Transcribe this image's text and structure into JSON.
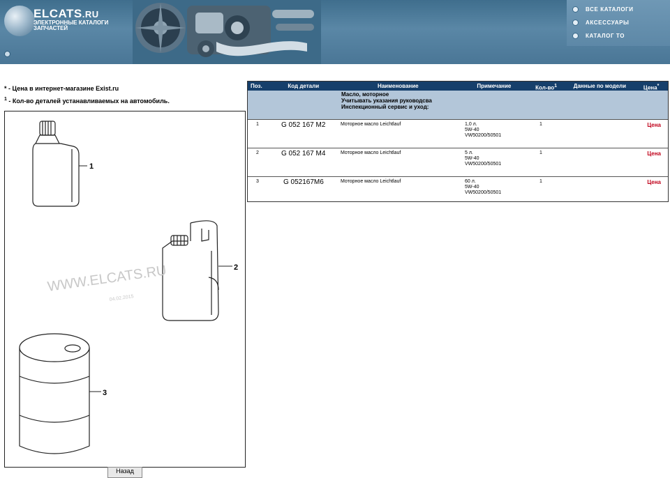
{
  "header": {
    "logo_title": "ELCATS",
    "logo_tld": ".RU",
    "logo_sub_1": "ЭЛЕКТРОННЫЕ КАТАЛОГИ",
    "logo_sub_2": "ЗАПЧАСТЕЙ",
    "nav": [
      {
        "label": "ВСЕ КАТАЛОГИ"
      },
      {
        "label": "АКСЕССУАРЫ"
      },
      {
        "label": "КАТАЛОГ ТО"
      }
    ]
  },
  "notes": {
    "star_mark": "*",
    "star_text": " - Цена в интернет-магазине Exist.ru",
    "qty_mark": "1",
    "qty_text": " - Кол-во деталей устанавливаемых на автомобиль."
  },
  "illustration": {
    "watermark": "WWW.ELCATS.RU",
    "date": "04.02.2015",
    "callouts": [
      "1",
      "2",
      "3"
    ],
    "print_button": "Назад"
  },
  "table": {
    "headers": {
      "pos": "Поз.",
      "code": "Код детали",
      "name": "Наименование",
      "note": "Примечание",
      "qty": "Кол-во",
      "qty_sup": "1",
      "model": "Данные по модели",
      "price": "Цена",
      "price_sup": "*"
    },
    "group": {
      "line1": "Масло, моторное",
      "line2": "Учитывать указания руководсва",
      "line3": "Инспекционный сервис и уход:"
    },
    "rows": [
      {
        "pos": "1",
        "code": "G 052 167 M2",
        "name": "Моторное масло Leichtlauf",
        "note1": "1,0 л.",
        "note2": "5W-40",
        "note3": "VW50200/50501",
        "qty": "1",
        "price": "Цена"
      },
      {
        "pos": "2",
        "code": "G 052 167 M4",
        "name": "Моторное масло Leichtlauf",
        "note1": "5 л.",
        "note2": "5W-40",
        "note3": "VW50200/50501",
        "qty": "1",
        "price": "Цена"
      },
      {
        "pos": "3",
        "code": "G 052167M6",
        "name": "Моторное масло Leichtlauf",
        "note1": "60 л.",
        "note2": "5W-40",
        "note3": "VW50200/50501",
        "qty": "1",
        "price": "Цена"
      }
    ]
  },
  "colors": {
    "header_bg": "#4a7696",
    "table_header_bg": "#163f6b",
    "group_row_bg": "#b3c6d9",
    "price_red": "#c0001a"
  }
}
